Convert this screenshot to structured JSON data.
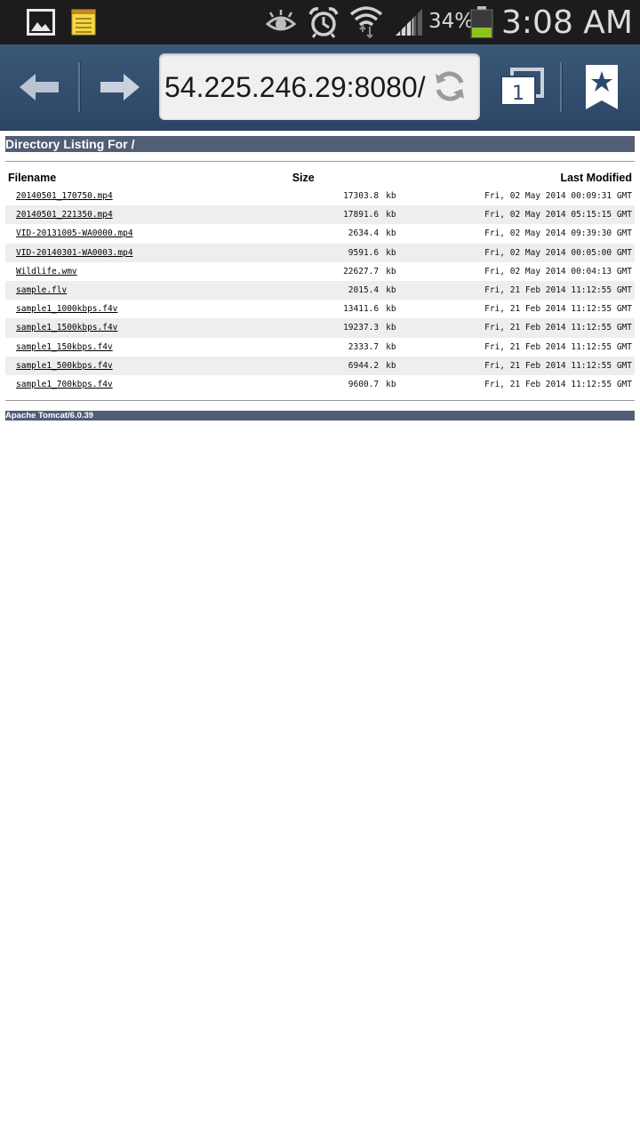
{
  "status_bar": {
    "battery_percent": "34%",
    "time": "3:08 AM",
    "icons": [
      "gallery-icon",
      "memo-icon",
      "smart-stay-eye-icon",
      "alarm-icon",
      "wifi-icon",
      "signal-icon",
      "battery-icon"
    ]
  },
  "browser": {
    "url": "54.225.246.29:8080/",
    "tab_count": "1",
    "icons": [
      "back-arrow-icon",
      "forward-arrow-icon",
      "reload-icon",
      "tabs-icon",
      "bookmark-icon"
    ]
  },
  "listing": {
    "title": "Directory Listing For /",
    "columns": {
      "filename": "Filename",
      "size": "Size",
      "modified": "Last Modified"
    },
    "files": [
      {
        "name": "20140501_170750.mp4",
        "size": "17303.8",
        "unit": "kb",
        "modified": "Fri, 02 May 2014 00:09:31 GMT"
      },
      {
        "name": "20140501_221350.mp4",
        "size": "17891.6",
        "unit": "kb",
        "modified": "Fri, 02 May 2014 05:15:15 GMT"
      },
      {
        "name": "VID-20131005-WA0000.mp4",
        "size": "2634.4",
        "unit": "kb",
        "modified": "Fri, 02 May 2014 09:39:30 GMT"
      },
      {
        "name": "VID-20140301-WA0003.mp4",
        "size": "9591.6",
        "unit": "kb",
        "modified": "Fri, 02 May 2014 00:05:00 GMT"
      },
      {
        "name": "Wildlife.wmv",
        "size": "22627.7",
        "unit": "kb",
        "modified": "Fri, 02 May 2014 00:04:13 GMT"
      },
      {
        "name": "sample.flv",
        "size": "2015.4",
        "unit": "kb",
        "modified": "Fri, 21 Feb 2014 11:12:55 GMT"
      },
      {
        "name": "sample1_1000kbps.f4v",
        "size": "13411.6",
        "unit": "kb",
        "modified": "Fri, 21 Feb 2014 11:12:55 GMT"
      },
      {
        "name": "sample1_1500kbps.f4v",
        "size": "19237.3",
        "unit": "kb",
        "modified": "Fri, 21 Feb 2014 11:12:55 GMT"
      },
      {
        "name": "sample1_150kbps.f4v",
        "size": "2333.7",
        "unit": "kb",
        "modified": "Fri, 21 Feb 2014 11:12:55 GMT"
      },
      {
        "name": "sample1_500kbps.f4v",
        "size": "6944.2",
        "unit": "kb",
        "modified": "Fri, 21 Feb 2014 11:12:55 GMT"
      },
      {
        "name": "sample1_700kbps.f4v",
        "size": "9600.7",
        "unit": "kb",
        "modified": "Fri, 21 Feb 2014 11:12:55 GMT"
      }
    ],
    "footer": "Apache Tomcat/6.0.39"
  },
  "colors": {
    "status_bar_bg": "#1c1c1c",
    "toolbar_bg": "#34506f",
    "tomcat_header": "#525d76",
    "battery_fill": "#8dc21f"
  }
}
